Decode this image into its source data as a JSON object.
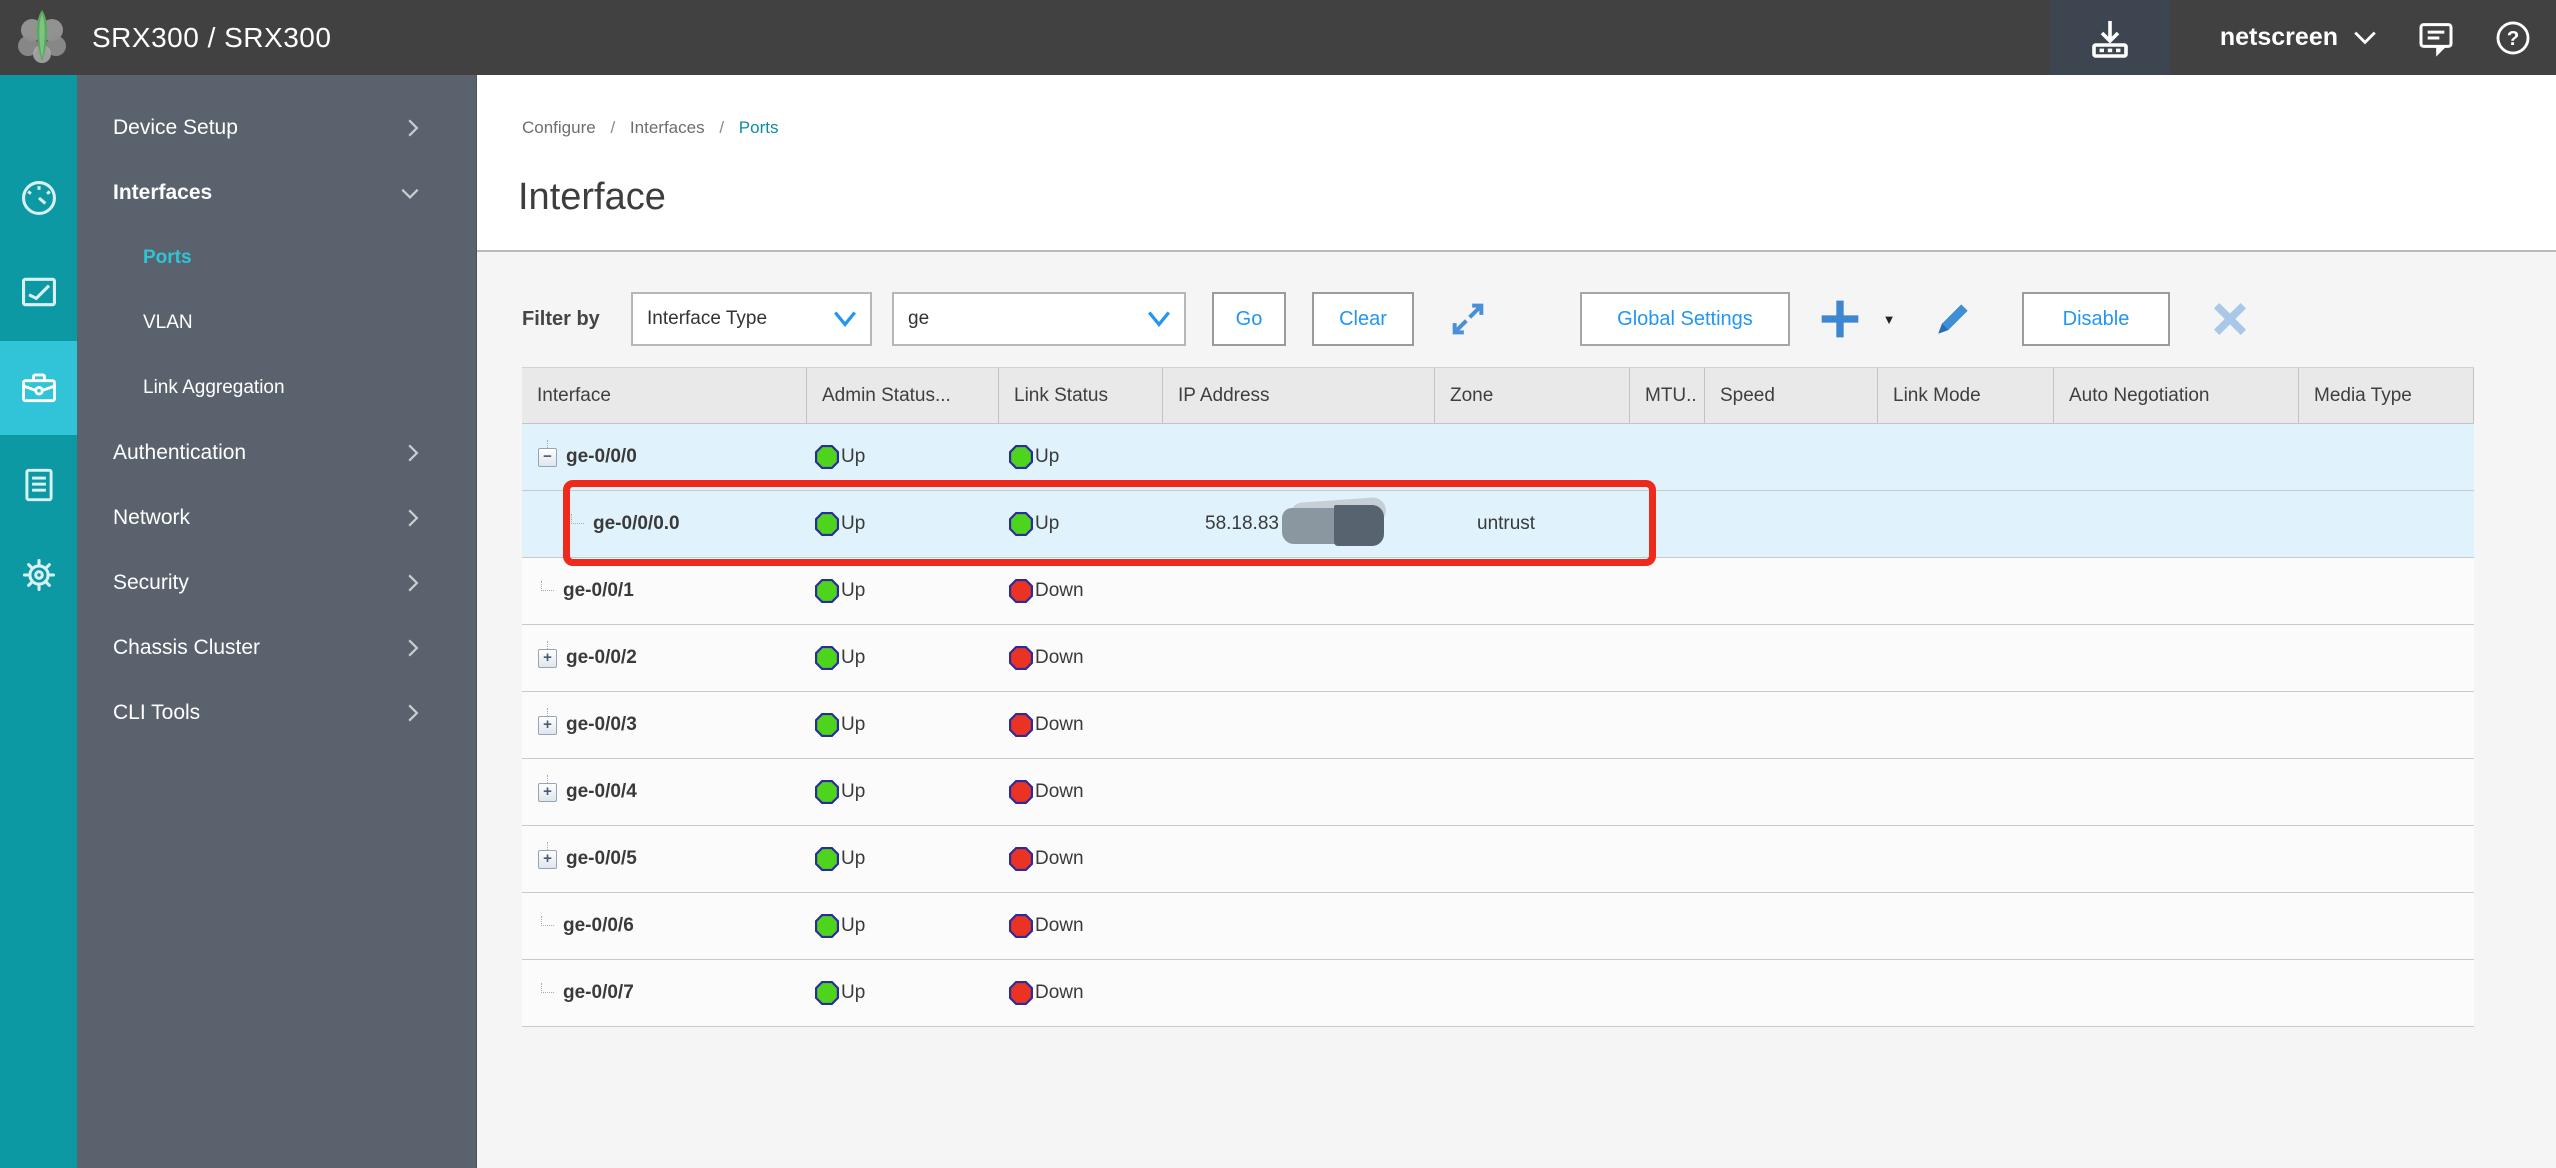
{
  "app": {
    "title": "SRX300 / SRX300",
    "user": "netscreen"
  },
  "topbar": {
    "icons": [
      "commit-download",
      "user-chevron",
      "feedback",
      "help"
    ]
  },
  "sidebar": {
    "nav_icons": [
      {
        "name": "dashboard",
        "active": false
      },
      {
        "name": "monitor",
        "active": false
      },
      {
        "name": "configure",
        "active": true
      },
      {
        "name": "reports",
        "active": false
      },
      {
        "name": "administration",
        "active": false
      }
    ],
    "menu": [
      {
        "label": "Device Setup",
        "chevron": "right"
      },
      {
        "label": "Interfaces",
        "chevron": "down",
        "expanded": true,
        "children": [
          {
            "label": "Ports",
            "active": true
          },
          {
            "label": "VLAN",
            "active": false
          },
          {
            "label": "Link Aggregation",
            "active": false
          }
        ]
      },
      {
        "label": "Authentication",
        "chevron": "right"
      },
      {
        "label": "Network",
        "chevron": "right"
      },
      {
        "label": "Security",
        "chevron": "right"
      },
      {
        "label": "Chassis Cluster",
        "chevron": "right"
      },
      {
        "label": "CLI Tools",
        "chevron": "right"
      }
    ]
  },
  "breadcrumb": {
    "items": [
      "Configure",
      "Interfaces",
      "Ports"
    ],
    "separator": "/"
  },
  "page": {
    "title": "Interface"
  },
  "filter": {
    "label": "Filter by",
    "type_dropdown_value": "Interface Type",
    "value_dropdown_value": "ge",
    "go": "Go",
    "clear": "Clear",
    "global_settings": "Global Settings",
    "disable": "Disable",
    "caret": "▼"
  },
  "table": {
    "columns": [
      "Interface",
      "Admin Status...",
      "Link Status",
      "IP Address",
      "Zone",
      "MTU..",
      "Speed",
      "Link Mode",
      "Auto Negotiation",
      "Media Type"
    ],
    "rows": [
      {
        "name": "ge-0/0/0",
        "tree": "minus",
        "child": false,
        "admin": "Up",
        "link": "Up",
        "ip": "",
        "redacted": false,
        "zone": "",
        "selected": true
      },
      {
        "name": "ge-0/0/0.0",
        "tree": "leaf",
        "child": true,
        "admin": "Up",
        "link": "Up",
        "ip": "58.18.83",
        "redacted": true,
        "zone": "untrust",
        "selected": true,
        "annotated": true
      },
      {
        "name": "ge-0/0/1",
        "tree": "leaf",
        "child": false,
        "admin": "Up",
        "link": "Down",
        "ip": "",
        "redacted": false,
        "zone": "",
        "selected": false
      },
      {
        "name": "ge-0/0/2",
        "tree": "plus",
        "child": false,
        "admin": "Up",
        "link": "Down",
        "ip": "",
        "redacted": false,
        "zone": "",
        "selected": false
      },
      {
        "name": "ge-0/0/3",
        "tree": "plus",
        "child": false,
        "admin": "Up",
        "link": "Down",
        "ip": "",
        "redacted": false,
        "zone": "",
        "selected": false
      },
      {
        "name": "ge-0/0/4",
        "tree": "plus",
        "child": false,
        "admin": "Up",
        "link": "Down",
        "ip": "",
        "redacted": false,
        "zone": "",
        "selected": false
      },
      {
        "name": "ge-0/0/5",
        "tree": "plus",
        "child": false,
        "admin": "Up",
        "link": "Down",
        "ip": "",
        "redacted": false,
        "zone": "",
        "selected": false
      },
      {
        "name": "ge-0/0/6",
        "tree": "leaf",
        "child": false,
        "admin": "Up",
        "link": "Down",
        "ip": "",
        "redacted": false,
        "zone": "",
        "selected": false
      },
      {
        "name": "ge-0/0/7",
        "tree": "leaf",
        "child": false,
        "admin": "Up",
        "link": "Down",
        "ip": "",
        "redacted": false,
        "zone": "",
        "selected": false
      }
    ]
  },
  "colors": {
    "topbar_bg": "#414141",
    "strip_teal": "#0c99a4",
    "strip_active": "#31c3d8",
    "sidebar_bg": "#5a636d",
    "accent_blue": "#2196f3",
    "selected_row": "#e0f2fb",
    "status_up": "#4fd41e",
    "status_down": "#ea3322",
    "status_ring": "#2b2ba0",
    "annotation_red": "#ee2a1c",
    "breadcrumb_active": "#0d8d9c",
    "sidebar_active_teal": "#2fc4d8"
  }
}
